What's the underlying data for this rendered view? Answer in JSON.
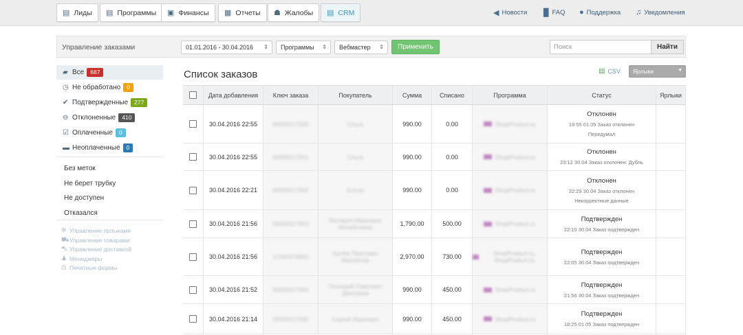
{
  "nav": {
    "items": [
      {
        "label": "Лиды",
        "icon": "list-icon",
        "glyph": "▤"
      },
      {
        "label": "Программы",
        "icon": "programs-icon",
        "glyph": "▤"
      },
      {
        "label": "Финансы",
        "icon": "briefcase-icon",
        "glyph": "▣"
      },
      {
        "label": "Отчеты",
        "icon": "calendar-icon",
        "glyph": "▦"
      },
      {
        "label": "Жалобы",
        "icon": "thumbs-down-icon",
        "glyph": "☗"
      },
      {
        "label": "CRM",
        "icon": "crm-icon",
        "glyph": "▤"
      }
    ],
    "active": "CRM",
    "links": [
      {
        "label": "Новости",
        "icon": "megaphone-icon",
        "glyph": "📢"
      },
      {
        "label": "FAQ",
        "icon": "document-icon",
        "glyph": "▉"
      },
      {
        "label": "Поддержка",
        "icon": "chat-icon",
        "glyph": "●"
      },
      {
        "label": "Уведомления",
        "icon": "bell-icon",
        "glyph": "🔔"
      }
    ]
  },
  "filters": {
    "title": "Управление заказами",
    "date_range": "01.01.2016 - 30.04.2016",
    "programs": "Программы",
    "webmaster": "Вебмастер",
    "apply": "Применить",
    "search_placeholder": "Поиск",
    "find": "Найти"
  },
  "sidebar": {
    "statuses": [
      {
        "label": "Все",
        "count": "687",
        "color": "#c9302c",
        "icon": "folder-open-icon",
        "glyph": "▰"
      },
      {
        "label": "Не обработано",
        "count": "0",
        "color": "#f0a30a",
        "icon": "clock-icon",
        "glyph": "◷"
      },
      {
        "label": "Подтвержденные",
        "count": "277",
        "color": "#7aa818",
        "icon": "check-icon",
        "glyph": "✔"
      },
      {
        "label": "Отклоненные",
        "count": "410",
        "color": "#555555",
        "icon": "minus-circle-icon",
        "glyph": "⊖"
      },
      {
        "label": "Оплаченные",
        "count": "0",
        "color": "#5bc0de",
        "icon": "check-square-icon",
        "glyph": "☑"
      },
      {
        "label": "Неоплаченные",
        "count": "0",
        "color": "#2a7ab8",
        "icon": "minus-icon",
        "glyph": "▬"
      }
    ],
    "labels": [
      "Без меток",
      "Не берет трубку",
      "Не доступен",
      "Отказался"
    ],
    "management": [
      {
        "label": "Управление ярлыками",
        "icon": "gear-icon",
        "glyph": "✲"
      },
      {
        "label": "Управление товарами",
        "icon": "cart-icon",
        "glyph": "⛟"
      },
      {
        "label": "Управление доставкой",
        "icon": "car-icon",
        "glyph": "⛍"
      },
      {
        "label": "Менеджеры",
        "icon": "user-icon",
        "glyph": "♟"
      },
      {
        "label": "Печатные формы",
        "icon": "print-icon",
        "glyph": "⎙"
      }
    ]
  },
  "main": {
    "title": "Список заказов",
    "csv": "CSV",
    "labels_select": "Ярлыки"
  },
  "table": {
    "columns": [
      "Дата добавления",
      "Ключ заказа",
      "Покупатель",
      "Сумма",
      "Списано",
      "Программа",
      "Статус",
      "Ярлыки"
    ],
    "rows": [
      {
        "date": "30.04.2016 22:55",
        "key": "00000017000",
        "buyer": "Ольга",
        "sum": "990.00",
        "written_off": "0.00",
        "program": "ShopProduct.ru",
        "status": "Отклонен",
        "sub1": "19:55 01.05 Заказ отклонен",
        "sub2": "Передумал"
      },
      {
        "date": "30.04.2016 22:55",
        "key": "00000017001",
        "buyer": "Ольга",
        "sum": "990.00",
        "written_off": "0.00",
        "program": "ShopProduct.ru",
        "status": "Отклонен",
        "sub1": "23:12 30.04 Заказ отклонен: Дубль",
        "sub2": ""
      },
      {
        "date": "30.04.2016 22:21",
        "key": "00000017002",
        "buyer": "Елена",
        "sum": "990.00",
        "written_off": "0.00",
        "program": "ShopProduct.ru",
        "status": "Отклонен",
        "sub1": "22:29 30.04 Заказ отклонен",
        "sub2": "Некорректные данные"
      },
      {
        "date": "30.04.2016 21:56",
        "key": "00000017003",
        "buyer": "Валерия Ивановна Михайловна",
        "sum": "1,790.00",
        "written_off": "500.00",
        "program": "ShopProduct.ru",
        "status": "Подтвержден",
        "sub1": "22:10 30.04 Заказ подтвержден",
        "sub2": ""
      },
      {
        "date": "30.04.2016 21:56",
        "key": "12345678902",
        "buyer": "Артём Павлович Михайлов",
        "sum": "2,970.00",
        "written_off": "730.00",
        "program": "ShopProduct.ru, ShopProduct.ru",
        "status": "Подтвержден",
        "sub1": "22:05 30.04 Заказ подтвержден",
        "sub2": ""
      },
      {
        "date": "30.04.2016 21:52",
        "key": "00000017004",
        "buyer": "Геннадий Павлович Дмитриев",
        "sum": "990.00",
        "written_off": "450.00",
        "program": "ShopProduct.ru",
        "status": "Подтвержден",
        "sub1": "21:56 30.04 Заказ подтвержден",
        "sub2": ""
      },
      {
        "date": "30.04.2016 21:14",
        "key": "00000017005",
        "buyer": "Сергей Иванович",
        "sum": "990.00",
        "written_off": "450.00",
        "program": "ShopProduct.ru",
        "status": "Подтвержден",
        "sub1": "18:25 01.05 Заказ подтвержден",
        "sub2": ""
      }
    ]
  }
}
